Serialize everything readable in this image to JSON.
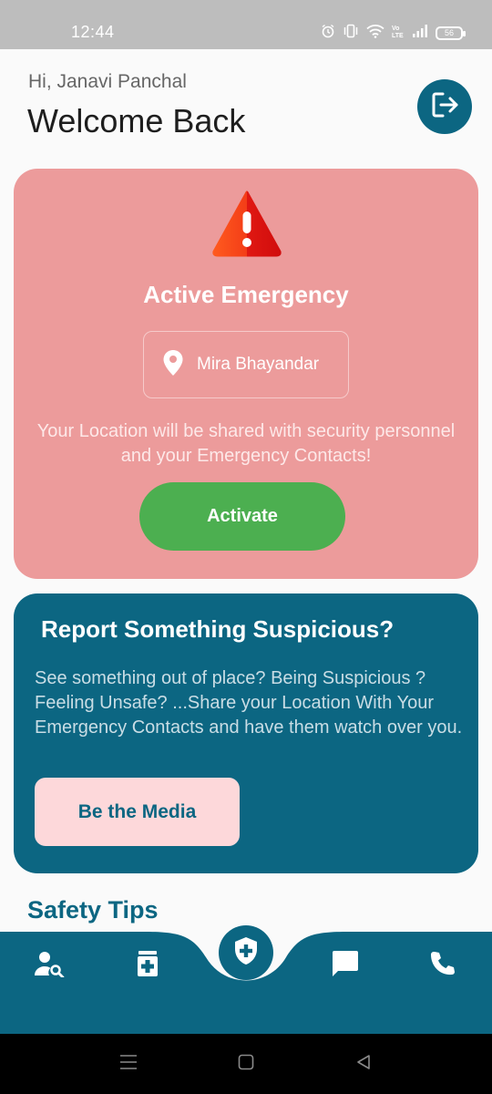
{
  "status_bar": {
    "time": "12:44",
    "battery": "56",
    "icons": [
      "alarm-icon",
      "vibrate-icon",
      "wifi-icon",
      "volte-icon",
      "signal-icon",
      "battery-icon"
    ]
  },
  "header": {
    "greeting": "Hi, Janavi Panchal",
    "title": "Welcome Back"
  },
  "emergency": {
    "title": "Active Emergency",
    "location": "Mira Bhayandar",
    "description": "Your Location will be shared with security personnel and your Emergency Contacts!",
    "button_label": "Activate"
  },
  "report": {
    "title": "Report Something Suspicious?",
    "description": "See something out of place? Being Suspicious ? Feeling Unsafe? ...Share your Location With Your Emergency Contacts and have them watch over you.",
    "button_label": "Be the Media"
  },
  "safety_tips": {
    "title": "Safety Tips"
  },
  "bottom_nav": {
    "items": [
      "user-search-icon",
      "medicine-icon",
      "shield-icon",
      "chat-icon",
      "phone-icon"
    ]
  },
  "colors": {
    "primary": "#0c6682",
    "emergency_bg": "#ec9b9b",
    "activate": "#4caf50",
    "media_button": "#fdd8da"
  }
}
